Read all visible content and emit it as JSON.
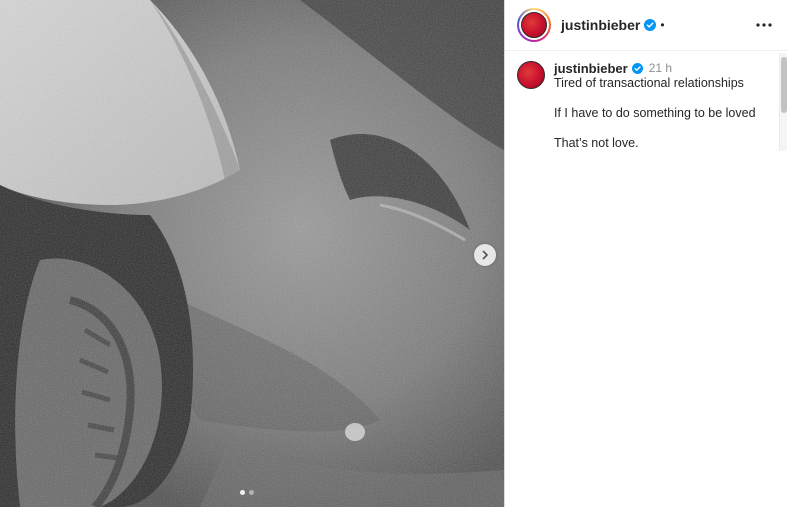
{
  "post": {
    "username": "justinbieber",
    "verified_icon": "verified-badge-icon",
    "header_dot": "•",
    "more_icon": "more-options-icon",
    "caption": {
      "username": "justinbieber",
      "time_ago": "21 h",
      "lines": [
        "Tired of transactional relationships",
        "If I have to do something to be loved",
        "That’s not love."
      ]
    },
    "media": {
      "next_icon": "chevron-right-icon",
      "slide_count": 2,
      "active_slide": 1
    }
  },
  "colors": {
    "verified": "#0095f6",
    "avatar": "#c8102e",
    "muted_text": "#8e8e8e"
  }
}
